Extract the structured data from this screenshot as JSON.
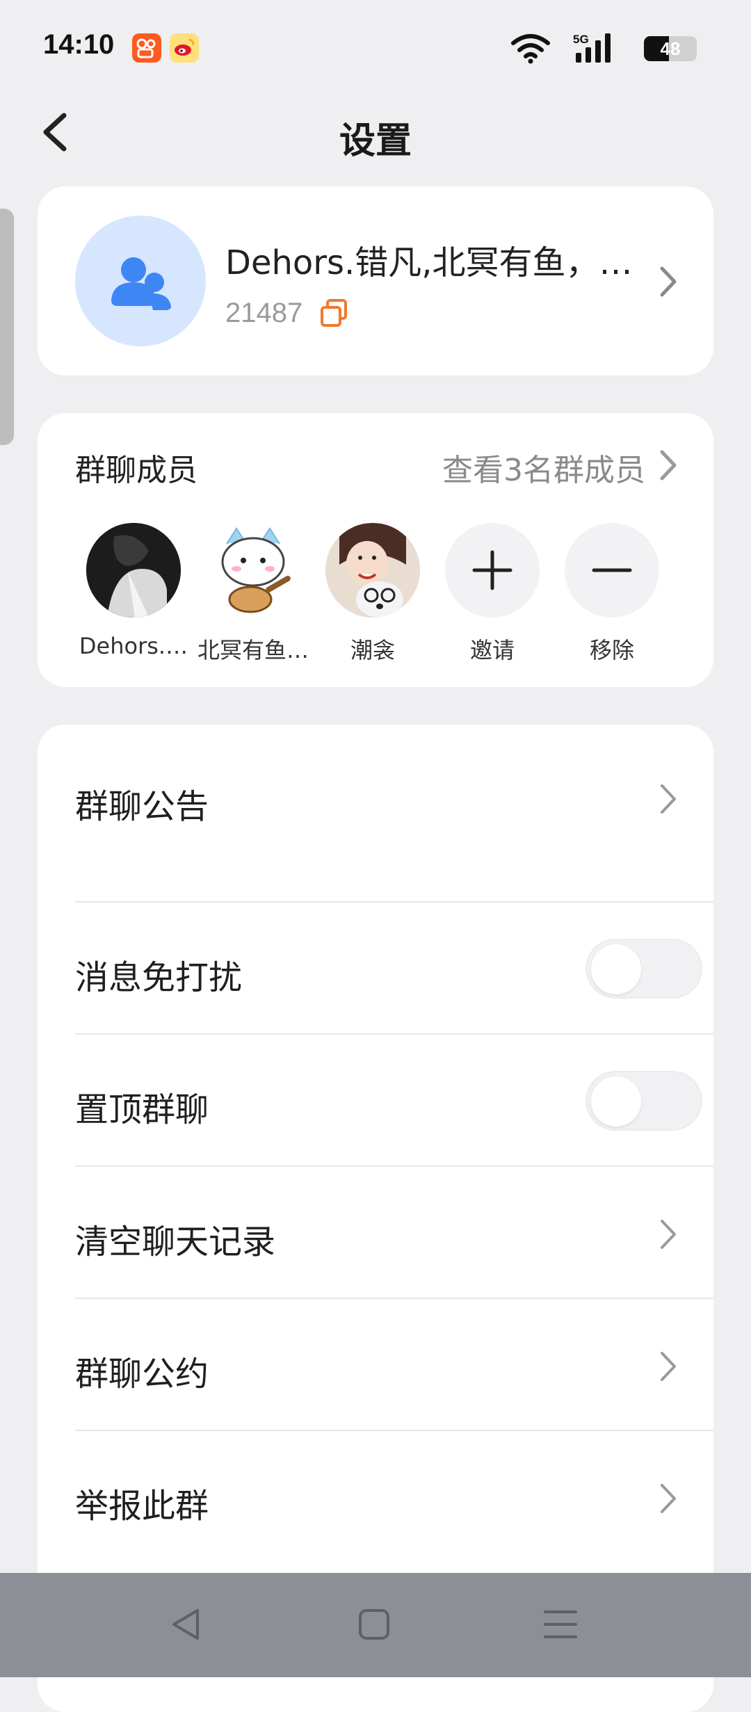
{
  "status_bar": {
    "time": "14:10",
    "network": "5G",
    "battery": "48",
    "battery_fraction": 0.48,
    "apps": [
      "kuaishou-icon",
      "weibo-icon"
    ]
  },
  "header": {
    "title": "设置",
    "back_icon": "chevron-left-icon"
  },
  "group": {
    "name": "Dehors.错凡,北冥有鱼，…",
    "id": "21487",
    "avatar_icon": "group-users-icon",
    "copy_icon": "copy-icon",
    "copy_color": "#f07a2c",
    "avatar_bg": "#d6e6ff",
    "avatar_fg": "#3f86f5"
  },
  "members": {
    "title": "群聊成员",
    "view_all": "查看3名群成员",
    "list": [
      {
        "name": "Dehors.…"
      },
      {
        "name": "北冥有鱼…"
      },
      {
        "name": "潮衾"
      }
    ],
    "invite_label": "邀请",
    "remove_label": "移除"
  },
  "settings": {
    "announcement": "群聊公告",
    "mute": {
      "label": "消息免打扰",
      "on": false
    },
    "pin": {
      "label": "置顶群聊",
      "on": false
    },
    "clear_history": "清空聊天记录",
    "rules": "群聊公约",
    "report": "举报此群"
  },
  "nav_bar": {
    "back": "back-triangle-icon",
    "home": "home-square-icon",
    "menu": "menu-lines-icon"
  }
}
